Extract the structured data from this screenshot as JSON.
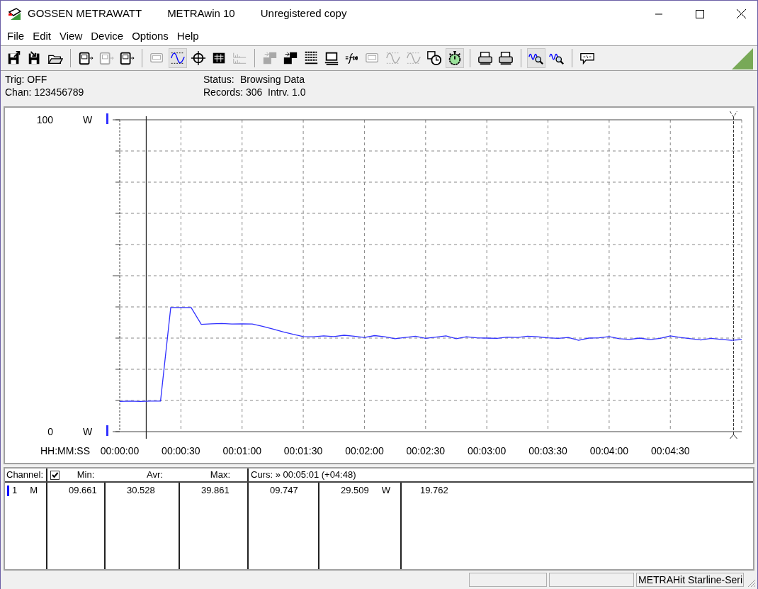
{
  "window": {
    "title_parts": [
      "GOSSEN METRAWATT",
      "METRAwin 10",
      "Unregistered copy"
    ]
  },
  "menu": [
    {
      "label": "File"
    },
    {
      "label": "Edit"
    },
    {
      "label": "View"
    },
    {
      "label": "Device"
    },
    {
      "label": "Options"
    },
    {
      "label": "Help"
    }
  ],
  "toolbar": [
    {
      "kind": "export",
      "disabled": false,
      "selected": false
    },
    {
      "kind": "import",
      "disabled": false,
      "selected": false
    },
    {
      "kind": "folder",
      "disabled": false,
      "selected": false
    },
    {
      "kind": "separator"
    },
    {
      "kind": "meter",
      "disabled": false,
      "selected": false
    },
    {
      "kind": "meter",
      "disabled": true,
      "selected": false
    },
    {
      "kind": "meter",
      "disabled": false,
      "selected": false
    },
    {
      "kind": "separator"
    },
    {
      "kind": "display",
      "disabled": true,
      "selected": false
    },
    {
      "kind": "wave",
      "disabled": false,
      "selected": true
    },
    {
      "kind": "crosshair",
      "disabled": false,
      "selected": false
    },
    {
      "kind": "table",
      "disabled": false,
      "selected": false
    },
    {
      "kind": "bars",
      "disabled": true,
      "selected": false
    },
    {
      "kind": "separator"
    },
    {
      "kind": "transfer",
      "disabled": true,
      "selected": false
    },
    {
      "kind": "transfer",
      "disabled": false,
      "selected": false
    },
    {
      "kind": "list",
      "disabled": false,
      "selected": false
    },
    {
      "kind": "monitor",
      "disabled": false,
      "selected": false
    },
    {
      "kind": "function",
      "disabled": false,
      "selected": false
    },
    {
      "kind": "display",
      "disabled": true,
      "selected": false
    },
    {
      "kind": "wave",
      "disabled": true,
      "selected": false
    },
    {
      "kind": "wave",
      "disabled": true,
      "selected": false
    },
    {
      "kind": "clock",
      "disabled": false,
      "selected": false
    },
    {
      "kind": "stopwatch",
      "disabled": false,
      "selected": true
    },
    {
      "kind": "separator"
    },
    {
      "kind": "printer",
      "disabled": false,
      "selected": false
    },
    {
      "kind": "printer",
      "disabled": false,
      "selected": false
    },
    {
      "kind": "separator"
    },
    {
      "kind": "zoom",
      "disabled": false,
      "selected": true
    },
    {
      "kind": "zoom",
      "disabled": false,
      "selected": false
    },
    {
      "kind": "separator"
    },
    {
      "kind": "comment",
      "disabled": false,
      "selected": false
    }
  ],
  "info": {
    "trig": "Trig: OFF",
    "chan": "Chan:  123456789",
    "status_label": "Status:",
    "status_value": "Browsing Data",
    "records": "Records: 306",
    "interval": "Intrv. 1.0"
  },
  "chart": {
    "units": [
      "W",
      "W"
    ],
    "chart_data": {
      "type": "line",
      "grid": true,
      "xlabel": "HH:MM:SS",
      "xlim": [
        0,
        305
      ],
      "ylim": [
        0,
        100
      ],
      "yticks": [
        {
          "value": 0,
          "label": "0"
        },
        {
          "value": 100,
          "label": "100"
        }
      ],
      "xticks": [
        {
          "value": 0,
          "label": "00:00:00"
        },
        {
          "value": 30,
          "label": "00:00:30"
        },
        {
          "value": 60,
          "label": "00:01:00"
        },
        {
          "value": 90,
          "label": "00:01:30"
        },
        {
          "value": 120,
          "label": "00:02:00"
        },
        {
          "value": 150,
          "label": "00:02:30"
        },
        {
          "value": 180,
          "label": "00:03:00"
        },
        {
          "value": 210,
          "label": "00:03:30"
        },
        {
          "value": 240,
          "label": "00:04:00"
        },
        {
          "value": 270,
          "label": "00:04:30"
        }
      ],
      "x": [
        0,
        5,
        10,
        15,
        20,
        25,
        30,
        35,
        40,
        45,
        50,
        55,
        60,
        65,
        70,
        75,
        80,
        85,
        90,
        95,
        100,
        105,
        110,
        115,
        120,
        125,
        130,
        135,
        140,
        145,
        150,
        155,
        160,
        165,
        170,
        175,
        180,
        185,
        190,
        195,
        200,
        205,
        210,
        215,
        220,
        225,
        230,
        235,
        240,
        245,
        250,
        255,
        260,
        265,
        270,
        275,
        280,
        285,
        290,
        295,
        300,
        305
      ],
      "series": [
        {
          "color": "#2f2fff",
          "values": [
            9.7,
            9.8,
            9.7,
            9.8,
            9.8,
            39.8,
            39.8,
            39.8,
            34.4,
            34.6,
            34.7,
            34.5,
            34.6,
            34.5,
            33.8,
            32.9,
            32.0,
            31.2,
            30.5,
            30.4,
            30.7,
            30.5,
            30.9,
            30.6,
            30.2,
            30.8,
            30.4,
            29.8,
            30.2,
            30.6,
            29.9,
            30.3,
            30.7,
            29.8,
            30.4,
            30.1,
            30.0,
            29.9,
            30.3,
            30.2,
            30.6,
            30.4,
            30.1,
            29.9,
            30.2,
            29.3,
            30.0,
            30.1,
            30.5,
            29.8,
            29.6,
            30.0,
            29.5,
            29.9,
            30.7,
            30.2,
            29.8,
            29.4,
            29.9,
            29.6,
            29.3,
            29.5
          ]
        }
      ],
      "ref_lines": [
        {
          "axis": "x",
          "value": 13
        },
        {
          "axis": "x",
          "value": 301
        }
      ]
    }
  },
  "table": {
    "channel_header": "Channel:",
    "all_checked": true,
    "headers": [
      "Min:",
      "Avr:",
      "Max:"
    ],
    "cursor_header": "Curs: » 00:05:01 (+04:48)",
    "rows": [
      {
        "color": "#0000ff",
        "number": "1",
        "mode": "M",
        "min": "09.661",
        "avr": "30.528",
        "max": "39.861",
        "cursor_1": "09.747",
        "cursor_2": "29.509",
        "unit": "W",
        "difference": "19.762"
      }
    ]
  },
  "status_bar": {
    "device": "METRAHit Starline-Seri"
  }
}
